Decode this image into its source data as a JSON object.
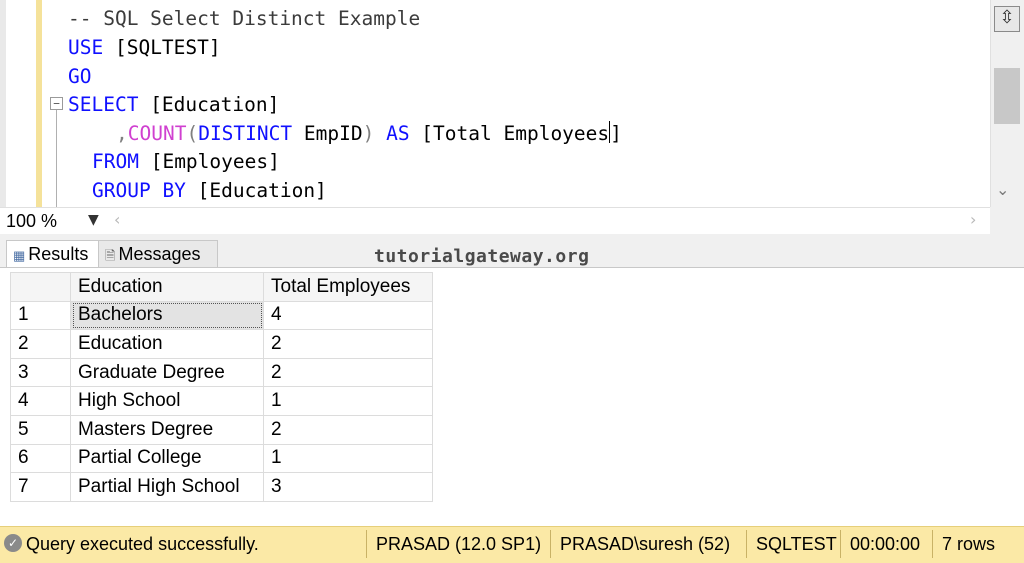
{
  "editor": {
    "lines": {
      "l1": "-- SQL Select Distinct Example",
      "l2_kw": "USE",
      "l2_rest": " [SQLTEST]",
      "l3_kw": "GO",
      "l4_kw": "SELECT",
      "l4_rest": " [Education]",
      "l5_comma": ",",
      "l5_fn": "COUNT",
      "l5_paren": "(",
      "l5_kw": "DISTINCT",
      "l5_mid": " EmpID",
      "l5_paren2": ")",
      "l5_as": "AS",
      "l5_rest": " [Total Employees",
      "l5_end": "]",
      "l6_kw": "FROM",
      "l6_rest": " [Employees]",
      "l7_kw": "GROUP BY",
      "l7_rest": " [Education]"
    },
    "collapse_symbol": "−"
  },
  "zoom": {
    "value": "100 %"
  },
  "tabs": {
    "results": "Results",
    "messages": "Messages"
  },
  "watermark": "tutorialgateway.org",
  "grid": {
    "columns": [
      "",
      "Education",
      "Total Employees"
    ],
    "rows": [
      [
        "1",
        "Bachelors",
        "4"
      ],
      [
        "2",
        "Education",
        "2"
      ],
      [
        "3",
        "Graduate Degree",
        "2"
      ],
      [
        "4",
        "High School",
        "1"
      ],
      [
        "5",
        "Masters Degree",
        "2"
      ],
      [
        "6",
        "Partial College",
        "1"
      ],
      [
        "7",
        "Partial High School",
        "3"
      ]
    ]
  },
  "status": {
    "message": "Query executed successfully.",
    "server": "PRASAD (12.0 SP1)",
    "user": "PRASAD\\suresh (52)",
    "database": "SQLTEST",
    "elapsed": "00:00:00",
    "rows": "7 rows"
  },
  "icons": {
    "split": "split-editor-icon",
    "status": "check-circle-icon",
    "results_tab": "grid-icon",
    "messages_tab": "message-icon"
  }
}
